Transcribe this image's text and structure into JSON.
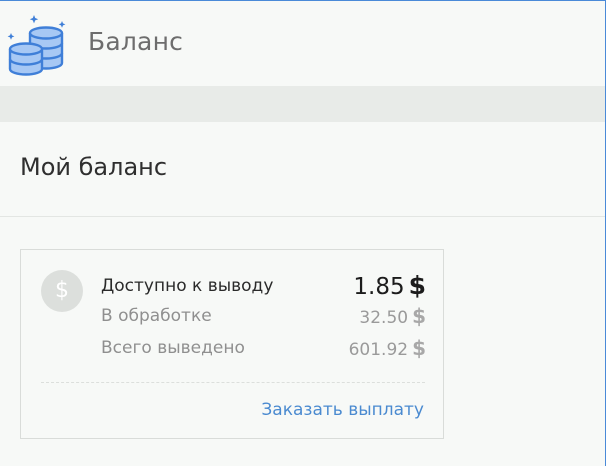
{
  "header": {
    "title": "Баланс",
    "icon": "coins-icon"
  },
  "page": {
    "title": "Мой баланс"
  },
  "balance": {
    "coin_icon": "dollar-coin-icon",
    "coin_symbol": "$",
    "available": {
      "label": "Доступно к выводу",
      "value": "1.85",
      "currency": "$"
    },
    "processing": {
      "label": "В обработке",
      "value": "32.50",
      "currency": "$"
    },
    "withdrawn": {
      "label": "Всего выведено",
      "value": "601.92",
      "currency": "$"
    },
    "action_label": "Заказать выплату"
  },
  "colors": {
    "accent": "#4a8ad0",
    "coin_fill": "#a7c8f4",
    "coin_stroke": "#3f7fd8"
  }
}
